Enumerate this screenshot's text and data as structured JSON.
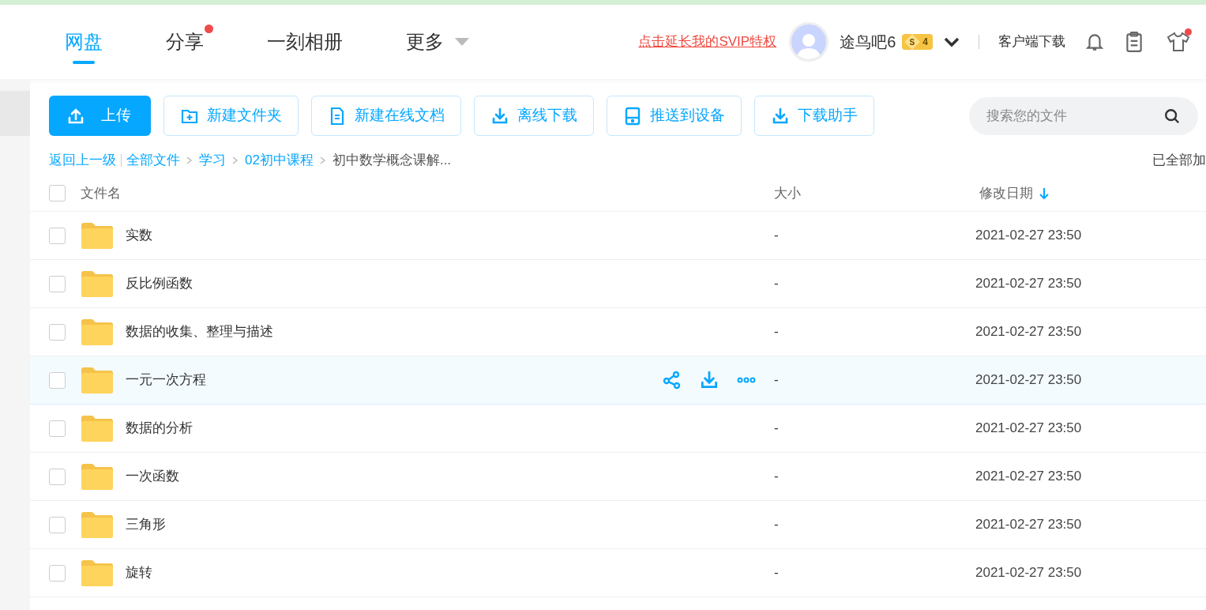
{
  "nav": {
    "tabs": [
      {
        "label": "网盘",
        "selected": true,
        "badge": false
      },
      {
        "label": "分享",
        "selected": false,
        "badge": true
      },
      {
        "label": "一刻相册",
        "selected": false,
        "badge": false
      },
      {
        "label": "更多",
        "selected": false,
        "badge": false,
        "dropdown": true
      }
    ],
    "promo_link": "点击延长我的SVIP特权",
    "username": "途鸟吧6",
    "vip_tier": "S",
    "vip_level": "4",
    "client_download": "客户端下载",
    "notifications_badge": false,
    "theme_badge": true
  },
  "toolbar": {
    "buttons": [
      {
        "kind": "upload",
        "label": "上传",
        "primary": true
      },
      {
        "kind": "new-folder",
        "label": "新建文件夹",
        "primary": false
      },
      {
        "kind": "new-doc",
        "label": "新建在线文档",
        "primary": false
      },
      {
        "kind": "download",
        "label": "离线下载",
        "primary": false
      },
      {
        "kind": "device",
        "label": "推送到设备",
        "primary": false
      },
      {
        "kind": "download",
        "label": "下载助手",
        "primary": false
      }
    ],
    "search": {
      "placeholder": "搜索您的文件"
    }
  },
  "breadcrumb": {
    "back": "返回上一级",
    "items": [
      "全部文件",
      "学习",
      "02初中课程",
      "初中数学概念课解..."
    ],
    "status": "已全部加"
  },
  "table": {
    "all_checked": false,
    "columns": [
      "文件名",
      "大小",
      "修改日期"
    ],
    "rows": [
      {
        "name": "实数",
        "size": "-",
        "modified": "2021-02-27 23:50",
        "checked": false,
        "hovered": false
      },
      {
        "name": "反比例函数",
        "size": "-",
        "modified": "2021-02-27 23:50",
        "checked": false,
        "hovered": false
      },
      {
        "name": "数据的收集、整理与描述",
        "size": "-",
        "modified": "2021-02-27 23:50",
        "checked": false,
        "hovered": false
      },
      {
        "name": "一元一次方程",
        "size": "-",
        "modified": "2021-02-27 23:50",
        "checked": false,
        "hovered": true
      },
      {
        "name": "数据的分析",
        "size": "-",
        "modified": "2021-02-27 23:50",
        "checked": false,
        "hovered": false
      },
      {
        "name": "一次函数",
        "size": "-",
        "modified": "2021-02-27 23:50",
        "checked": false,
        "hovered": false
      },
      {
        "name": "三角形",
        "size": "-",
        "modified": "2021-02-27 23:50",
        "checked": false,
        "hovered": false
      },
      {
        "name": "旋转",
        "size": "-",
        "modified": "2021-02-27 23:50",
        "checked": false,
        "hovered": false
      }
    ]
  }
}
